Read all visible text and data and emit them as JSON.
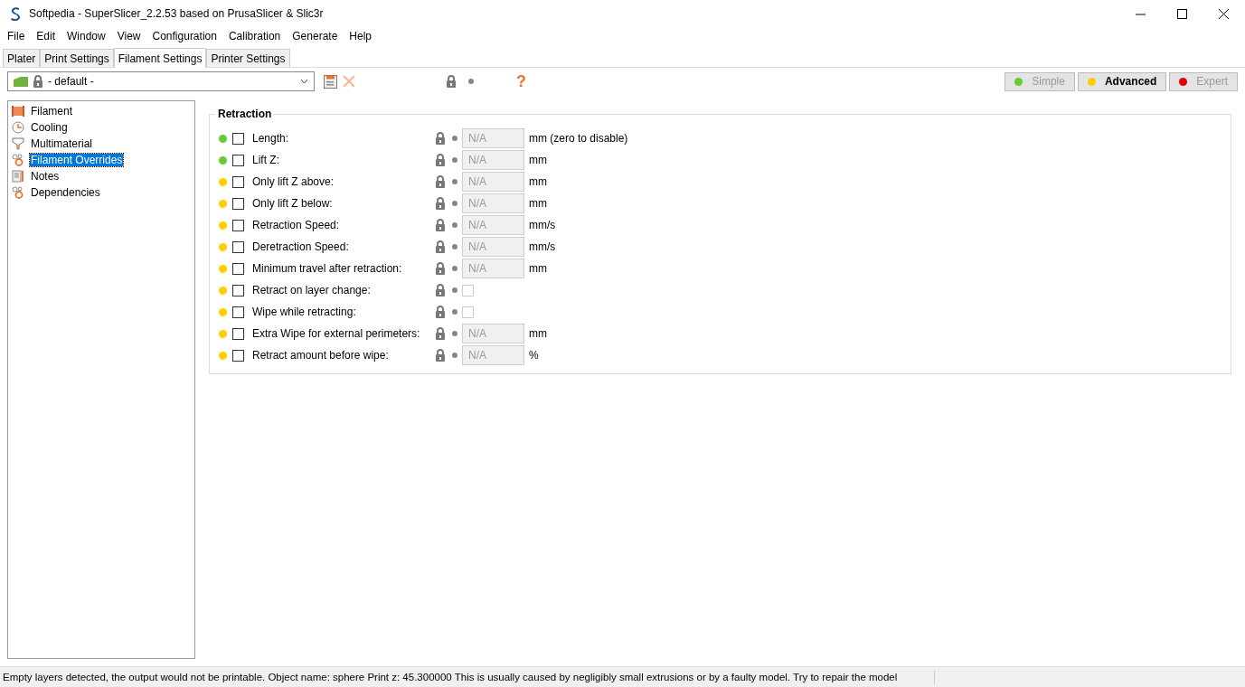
{
  "window": {
    "title": "Softpedia - SuperSlicer_2.2.53 based on PrusaSlicer & Slic3r"
  },
  "menu": [
    "File",
    "Edit",
    "Window",
    "View",
    "Configuration",
    "Calibration",
    "Generate",
    "Help"
  ],
  "tabs": [
    {
      "label": "Plater",
      "selected": false
    },
    {
      "label": "Print Settings",
      "selected": false
    },
    {
      "label": "Filament Settings",
      "selected": true
    },
    {
      "label": "Printer Settings",
      "selected": false
    }
  ],
  "preset": {
    "value": "- default -"
  },
  "help_mark": "?",
  "modes": [
    {
      "label": "Simple",
      "color": "#66cc33",
      "selected": false
    },
    {
      "label": "Advanced",
      "color": "#ffcc00",
      "selected": true
    },
    {
      "label": "Expert",
      "color": "#dd0000",
      "selected": false
    }
  ],
  "sidebar": {
    "items": [
      {
        "label": "Filament",
        "selected": false
      },
      {
        "label": "Cooling",
        "selected": false
      },
      {
        "label": "Multimaterial",
        "selected": false
      },
      {
        "label": "Filament Overrides",
        "selected": true
      },
      {
        "label": "Notes",
        "selected": false
      },
      {
        "label": "Dependencies",
        "selected": false
      }
    ]
  },
  "section": {
    "title": "Retraction",
    "rows": [
      {
        "label": "Length:",
        "color": "#66cc33",
        "checked": false,
        "kind": "field",
        "value": "N/A",
        "disabled": true,
        "unit": "mm (zero to disable)"
      },
      {
        "label": "Lift Z:",
        "color": "#66cc33",
        "checked": false,
        "kind": "field",
        "value": "N/A",
        "disabled": true,
        "unit": "mm"
      },
      {
        "label": "Only lift Z above:",
        "color": "#ffcc00",
        "checked": false,
        "kind": "field",
        "value": "N/A",
        "disabled": true,
        "unit": "mm"
      },
      {
        "label": "Only lift Z below:",
        "color": "#ffcc00",
        "checked": false,
        "kind": "field",
        "value": "N/A",
        "disabled": true,
        "unit": "mm"
      },
      {
        "label": "Retraction Speed:",
        "color": "#ffcc00",
        "checked": false,
        "kind": "field",
        "value": "N/A",
        "disabled": true,
        "unit": "mm/s"
      },
      {
        "label": "Deretraction Speed:",
        "color": "#ffcc00",
        "checked": false,
        "kind": "field",
        "value": "N/A",
        "disabled": true,
        "unit": "mm/s"
      },
      {
        "label": "Minimum travel after retraction:",
        "color": "#ffcc00",
        "checked": false,
        "kind": "field",
        "value": "N/A",
        "disabled": true,
        "unit": "mm"
      },
      {
        "label": "Retract on layer change:",
        "color": "#ffcc00",
        "checked": false,
        "kind": "checkbox",
        "value_checked": false
      },
      {
        "label": "Wipe while retracting:",
        "color": "#ffcc00",
        "checked": false,
        "kind": "checkbox",
        "value_checked": false
      },
      {
        "label": "Extra Wipe for external perimeters:",
        "color": "#ffcc00",
        "checked": false,
        "kind": "field",
        "value": "N/A",
        "disabled": true,
        "unit": "mm"
      },
      {
        "label": "Retract amount before wipe:",
        "color": "#ffcc00",
        "checked": false,
        "kind": "field",
        "value": "N/A",
        "disabled": true,
        "unit": "%"
      }
    ]
  },
  "status_bar": "Empty layers detected, the output would not be printable.  Object name: sphere Print z: 45.300000  This is usually caused by negligibly small extrusions or by a faulty model. Try to repair the model"
}
